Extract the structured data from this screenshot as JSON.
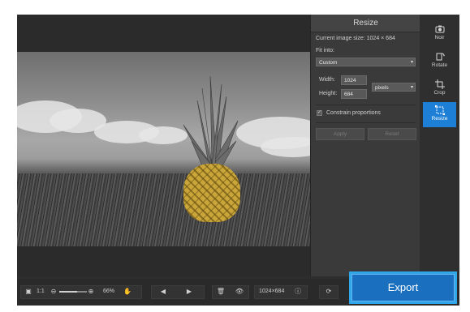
{
  "panel": {
    "title": "Resize",
    "current_size_label": "Current image size: 1024 × 684",
    "fit_into_label": "Fit into:",
    "fit_into_value": "Custom",
    "width_label": "Width:",
    "width_value": "1024",
    "height_label": "Height:",
    "height_value": "684",
    "unit_value": "pixels",
    "constrain_label": "Constrain proportions",
    "constrain_checked": true,
    "apply_label": "Apply",
    "reset_label": "Reset"
  },
  "tools": [
    {
      "label": "Noir",
      "icon": "camera-icon"
    },
    {
      "label": "Rotate",
      "icon": "rotate-icon"
    },
    {
      "label": "Crop",
      "icon": "crop-icon"
    },
    {
      "label": "Resize",
      "icon": "resize-icon",
      "active": true
    }
  ],
  "bottombar": {
    "fit_label": "1:1",
    "zoom_value": "66%",
    "dimensions": "1024×684"
  },
  "export_label": "Export",
  "colors": {
    "accent": "#1e7fd6",
    "export_border": "#2fa7e8",
    "panel_bg": "#3a3a3a",
    "app_bg": "#2e2e2e"
  }
}
